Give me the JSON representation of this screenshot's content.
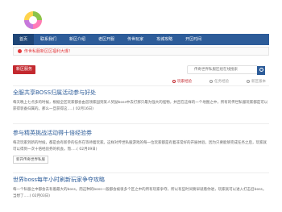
{
  "nav": {
    "items": [
      "首页",
      "联系我们",
      "新区介绍",
      "老区开服",
      "传世玩家",
      "攻城攻略",
      "开区时间"
    ]
  },
  "notice": {
    "text": "传世私服新区区福利大爆！"
  },
  "subbar": {
    "tag_label": "新区服务",
    "search_placeholder": "传奇世界私服区组在线搜索",
    "tabs": [
      "玩家经验",
      "任务经验",
      "新区版本"
    ]
  },
  "articles": [
    {
      "title": "全服共享BOSS归属活动参与好处",
      "body": "每天晚上七点多的时候，根据全区玩家都会由首领家园到某人奖励boss中去打那只最为强大的怪物，并且在这样的一个地图之中，所有的传世私服玩家都是可以获得装备归属的。那么一旦获得这.....( 02月16日)",
      "meta": ""
    },
    {
      "title": "参与精英挑战活动得十倍经验券",
      "body": "每次玩家到新的时候，都是会有新参的任务在等待着玩家。这样对传世私服游戏的每一位玩家都是有着非常好的开展体验，因为只要能够完成任务之后，玩家就可以得到一次十倍经验券的机会。而.....( 02月09日)",
      "meta": "新开传奇世界私服"
    },
    {
      "title": "世界boss每年小时刷新玩家争夺攻略",
      "body": "每一个私服之中都会去有着最大的boss。而这种的boss一般都会被很多个区之中的所有玩家争夺，所以有些时间要早就看你进，玩家就可以进入打击召boss。当想了.....( 02月03日)",
      "meta": ""
    }
  ],
  "colors": {
    "nav_bg": "#2d5c99",
    "accent_red": "#c3292f",
    "link_blue": "#2d5c99"
  }
}
